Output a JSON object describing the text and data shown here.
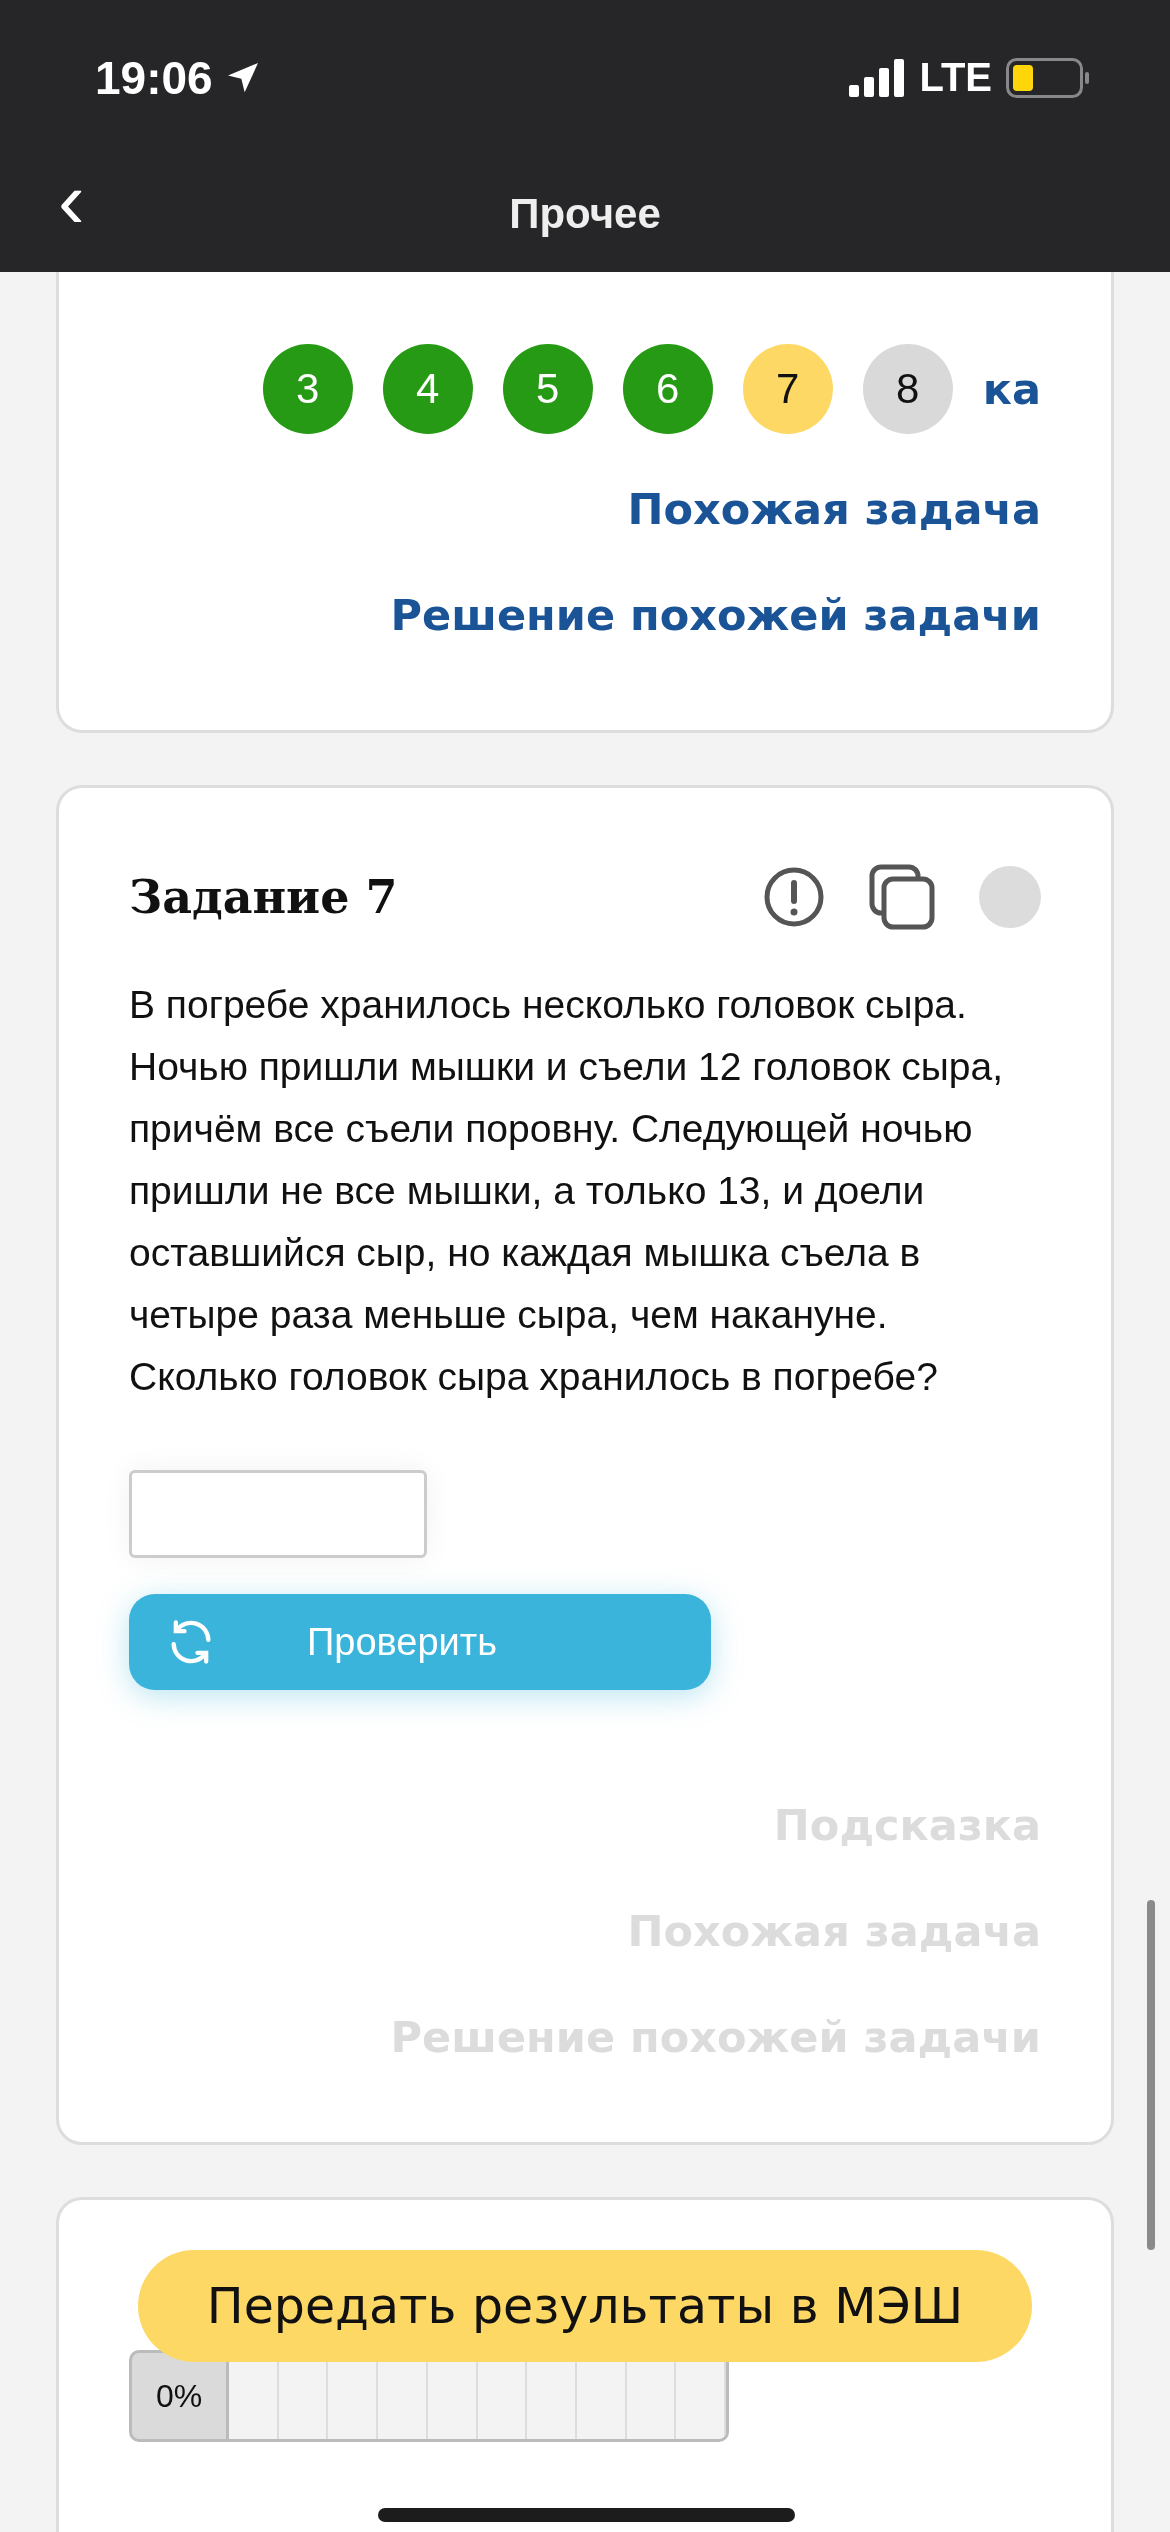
{
  "status_bar": {
    "time": "19:06",
    "network": "LTE"
  },
  "nav": {
    "title": "Прочее",
    "back": "‹"
  },
  "prev_card": {
    "steps": [
      {
        "label": "3",
        "color": "#279a15"
      },
      {
        "label": "4",
        "color": "#279a15"
      },
      {
        "label": "5",
        "color": "#279a15"
      },
      {
        "label": "6",
        "color": "#279a15"
      },
      {
        "label": "7",
        "color": "#fdd865"
      },
      {
        "label": "8",
        "color": "#d9d9d9"
      }
    ],
    "hint_fragment": "ка",
    "links": [
      {
        "label": "Похожая задача",
        "disabled": false
      },
      {
        "label": "Решение похожей задачи",
        "disabled": false
      }
    ]
  },
  "task": {
    "title": "Задание 7",
    "text": "В погребе хранилось несколько головок сыра. Ночью пришли мышки и съели 12 головок сыра, причём все съели поровну. Следующей ночью пришли не все мышки, а только 13, и доели оставшийся сыр, но каждая мышка съела в четыре раза меньше сыра, чем накануне. Сколько головок сыра хранилось в погребе?",
    "check_button": "Проверить",
    "links": [
      {
        "label": "Подсказка",
        "disabled": true
      },
      {
        "label": "Похожая задача",
        "disabled": true
      },
      {
        "label": "Решение похожей задачи",
        "disabled": true
      }
    ]
  },
  "next_card": {
    "progress": {
      "label": "0%",
      "level": 0
    }
  },
  "submit_button": "Передать результаты в МЭШ"
}
